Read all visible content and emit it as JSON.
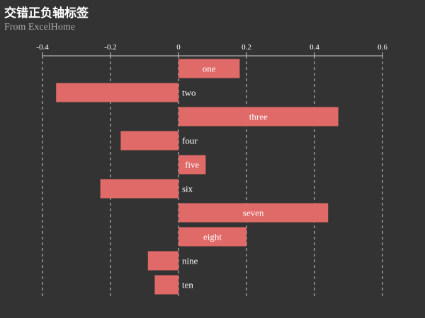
{
  "colors": {
    "background": "#333333",
    "bar": "#E06A68",
    "grid": "#cccccc",
    "text": "#ffffff",
    "subtitle": "#aaaaaa"
  },
  "chart_data": {
    "type": "bar",
    "orientation": "horizontal",
    "title": "交错正负轴标签",
    "subtitle": "From ExcelHome",
    "categories": [
      "one",
      "two",
      "three",
      "four",
      "five",
      "six",
      "seven",
      "eight",
      "nine",
      "ten"
    ],
    "values": [
      0.18,
      -0.36,
      0.47,
      -0.17,
      0.08,
      -0.23,
      0.44,
      0.2,
      -0.09,
      -0.07
    ],
    "xlim": [
      -0.4,
      0.6
    ],
    "xticks": [
      -0.4,
      -0.2,
      0,
      0.2,
      0.4,
      0.6
    ],
    "xtick_labels": [
      "-0.4",
      "-0.2",
      "0",
      "0.2",
      "0.4",
      "0.6"
    ],
    "axis_position": "top",
    "grid": true,
    "grid_style": "dashed",
    "label_placement": "inside bar for positive values, right of zero line for negative values",
    "legend": false
  }
}
